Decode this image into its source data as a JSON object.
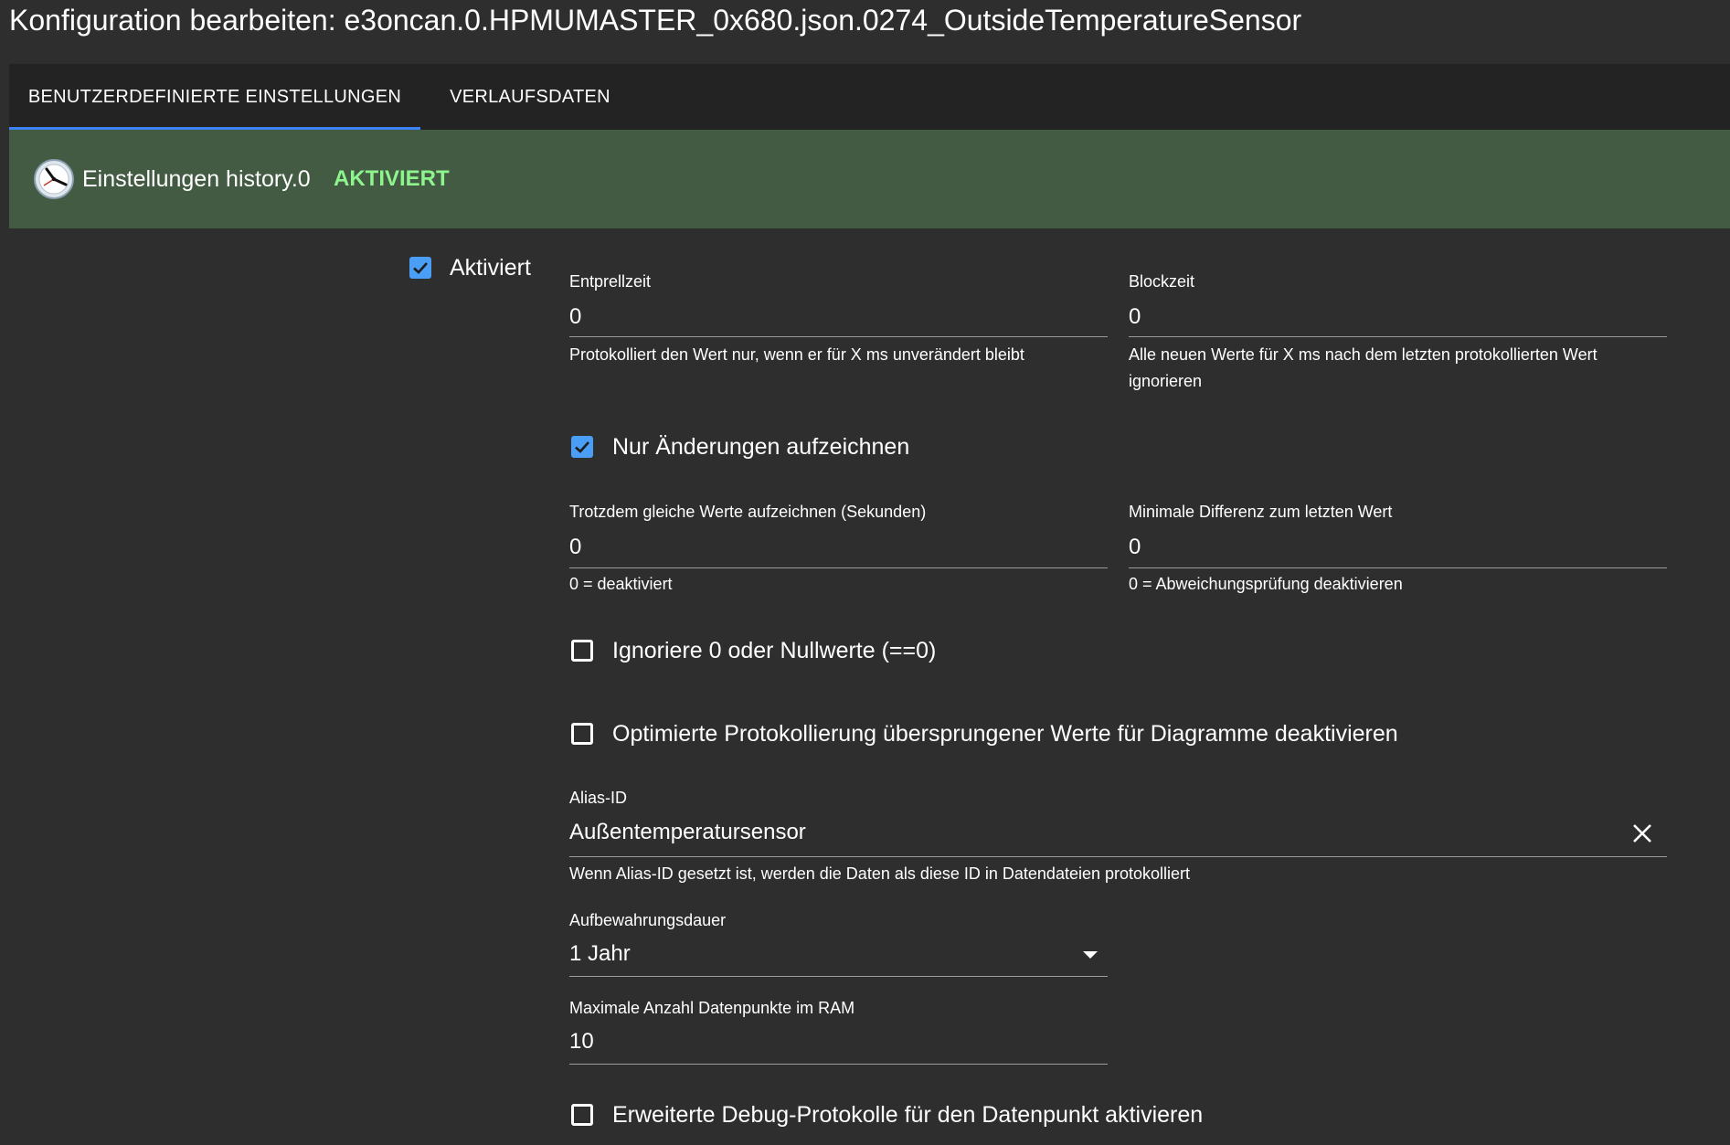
{
  "window": {
    "title": "Konfiguration bearbeiten: e3oncan.0.HPMUMASTER_0x680.json.0274_OutsideTemperatureSensor"
  },
  "tabs": [
    {
      "label": "BENUTZERDEFINIERTE EINSTELLUNGEN",
      "active": true
    },
    {
      "label": "VERLAUFSDATEN",
      "active": false
    }
  ],
  "banner": {
    "title": "Einstellungen history.0",
    "status": "AKTIVIERT",
    "icon": "history-clock-icon",
    "status_color": "#8ef48e",
    "background_color": "#435b43"
  },
  "form": {
    "enabled": {
      "label": "Aktiviert",
      "checked": true
    },
    "debounce": {
      "label": "Entprellzeit",
      "value": "0",
      "help": "Protokolliert den Wert nur, wenn er für X ms unverändert bleibt"
    },
    "blocktime": {
      "label": "Blockzeit",
      "value": "0",
      "help": "Alle neuen Werte für X ms nach dem letzten protokollierten Wert ignorieren"
    },
    "changes_only": {
      "label": "Nur Änderungen aufzeichnen",
      "checked": true
    },
    "record_same": {
      "label": "Trotzdem gleiche Werte aufzeichnen (Sekunden)",
      "value": "0",
      "help": "0 = deaktiviert"
    },
    "min_diff": {
      "label": "Minimale Differenz zum letzten Wert",
      "value": "0",
      "help": "0 = Abweichungsprüfung deaktivieren"
    },
    "ignore_zero": {
      "label": "Ignoriere 0 oder Nullwerte (==0)",
      "checked": false
    },
    "disable_optimized": {
      "label": "Optimierte Protokollierung übersprungener Werte für Diagramme deaktivieren",
      "checked": false
    },
    "alias": {
      "label": "Alias-ID",
      "value": "Außentemperatursensor",
      "help": "Wenn Alias-ID gesetzt ist, werden die Daten als diese ID in Datendateien protokolliert"
    },
    "retention": {
      "label": "Aufbewahrungsdauer",
      "value": "1 Jahr"
    },
    "max_points": {
      "label": "Maximale Anzahl Datenpunkte im RAM",
      "value": "10"
    },
    "debug": {
      "label": "Erweiterte Debug-Protokolle für den Datenpunkt aktivieren",
      "checked": false
    }
  },
  "colors": {
    "background": "#2e2e2e",
    "tabbar": "#232323",
    "accent": "#3b82f6",
    "checkbox": "#4a9ef5"
  }
}
